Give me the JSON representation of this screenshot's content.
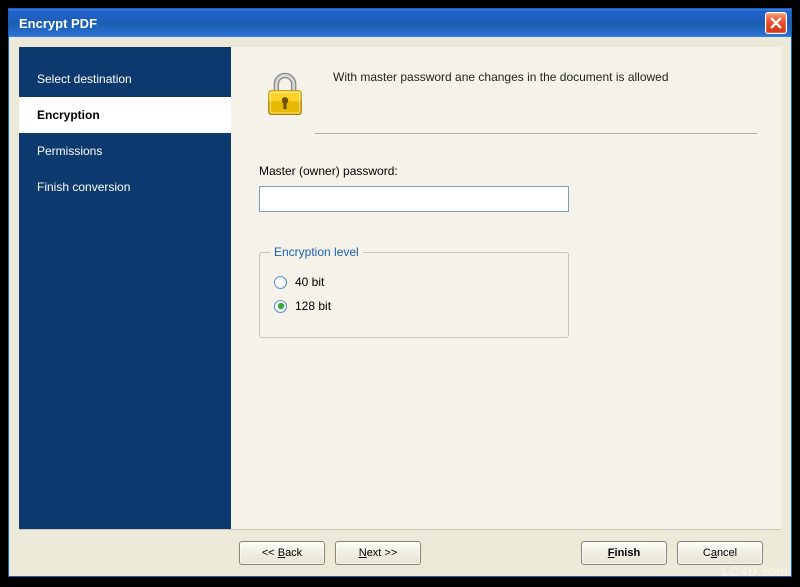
{
  "window": {
    "title": "Encrypt PDF"
  },
  "sidebar": {
    "items": [
      {
        "label": "Select destination",
        "active": false
      },
      {
        "label": "Encryption",
        "active": true
      },
      {
        "label": "Permissions",
        "active": false
      },
      {
        "label": "Finish conversion",
        "active": false
      }
    ]
  },
  "main": {
    "description": "With master password ane changes in the document is allowed",
    "password_label": "Master (owner) password:",
    "password_value": "",
    "group_legend": "Encryption level",
    "encryption_options": [
      {
        "label": "40 bit",
        "checked": false
      },
      {
        "label": "128 bit",
        "checked": true
      }
    ]
  },
  "buttons": {
    "back": {
      "prefix": "<< ",
      "accel": "B",
      "rest": "ack"
    },
    "next": {
      "prefix": "",
      "accel": "N",
      "rest": "ext >>"
    },
    "finish": {
      "prefix": "",
      "accel": "F",
      "rest": "inish",
      "bold": true
    },
    "cancel": {
      "prefix": "C",
      "accel": "a",
      "rest": "ncel"
    }
  },
  "watermark": "LO4D.com",
  "colors": {
    "titlebar": "#1b5eb0",
    "sidebar": "#0d3a6e",
    "panel": "#ece9d8",
    "accent_green": "#3aa63a"
  }
}
